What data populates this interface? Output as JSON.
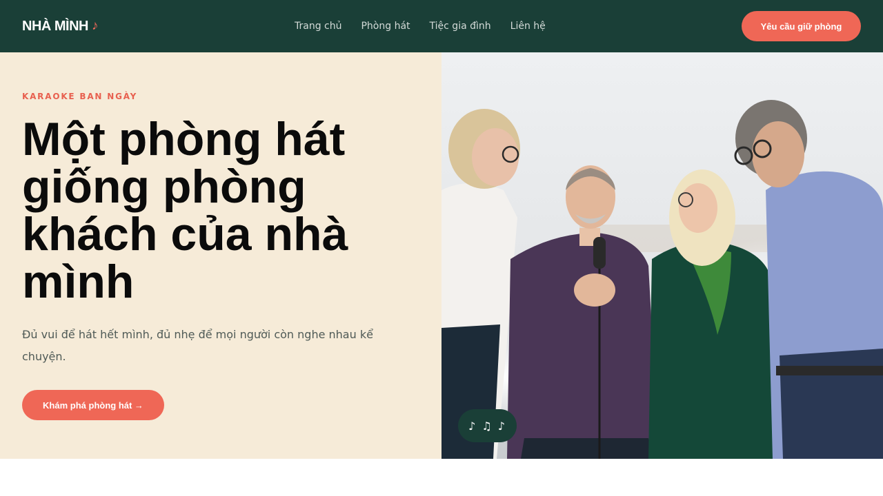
{
  "header": {
    "brand": "NHÀ MÌNH",
    "brand_note": "♪",
    "nav": [
      "Trang chủ",
      "Phòng hát",
      "Tiệc gia đình",
      "Liên hệ"
    ],
    "cta": "Yêu cầu giữ phòng"
  },
  "hero": {
    "eyebrow": "KARAOKE BAN NGÀY",
    "headline": "Một phòng hát giống phòng khách của nhà mình",
    "subtext": "Đủ vui để hát hết mình, đủ nhẹ để mọi người còn nghe nhau kể chuyện.",
    "cta": "Khám phá phòng hát →",
    "notes_badge": "♪ ♫ ♪"
  },
  "colors": {
    "header_bg": "#1a3f37",
    "accent": "#ef6756",
    "hero_bg": "#f6ebd8"
  }
}
